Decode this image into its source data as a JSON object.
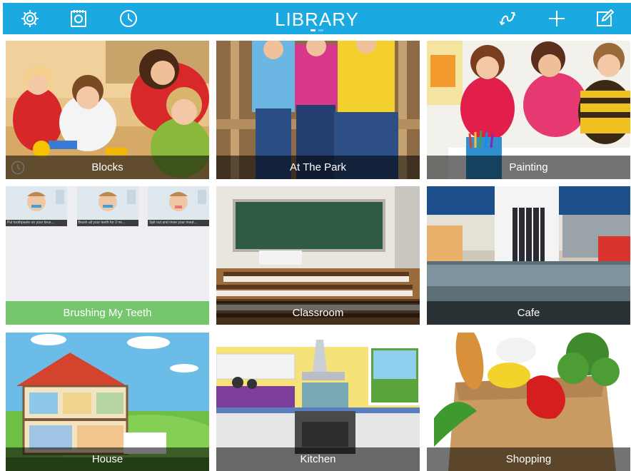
{
  "header": {
    "title": "LIBRARY",
    "accent": "#1ba9e1",
    "left_icons": [
      "gear-icon",
      "notebook-icon",
      "clock-icon"
    ],
    "right_icons": [
      "sync-icon",
      "plus-icon",
      "compose-icon"
    ],
    "page_count": 2,
    "current_page": 1
  },
  "tiles": [
    {
      "label": "Blocks",
      "scene": "children playing with wooden blocks",
      "badge": "clock-icon"
    },
    {
      "label": "At The Park",
      "scene": "kids sitting on a wooden playground"
    },
    {
      "label": "Painting",
      "scene": "children painting with a teacher"
    },
    {
      "label": "Brushing My Teeth",
      "scene": "three steps of a child brushing teeth",
      "caption_color": "#76c66e",
      "steps": [
        "Put toothpaste on your brus…",
        "Brush all your teeth for 2 mi…",
        "Spit out and rinse your mout…"
      ]
    },
    {
      "label": "Classroom",
      "scene": "empty classroom with desks and chalkboard"
    },
    {
      "label": "Cafe",
      "scene": "cafe counter with server in apron"
    },
    {
      "label": "House",
      "scene": "cutaway illustration of a house"
    },
    {
      "label": "Kitchen",
      "scene": "illustrated kitchen with stove and hood"
    },
    {
      "label": "Shopping",
      "scene": "paper grocery bag with vegetables"
    }
  ]
}
